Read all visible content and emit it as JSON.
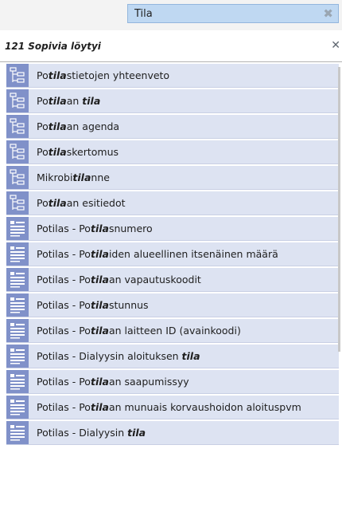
{
  "search": {
    "value": "Tila",
    "clear_icon": "close-icon"
  },
  "results": {
    "count_label": "121 Sopivia löytyi",
    "close_icon": "close-icon"
  },
  "items": [
    {
      "icon": "tree-icon",
      "segments": [
        {
          "t": "Po"
        },
        {
          "t": "tila",
          "b": true
        },
        {
          "t": "stietojen yhteenveto"
        }
      ]
    },
    {
      "icon": "tree-icon",
      "segments": [
        {
          "t": "Po"
        },
        {
          "t": "tila",
          "b": true
        },
        {
          "t": "an "
        },
        {
          "t": "tila",
          "b": true
        }
      ]
    },
    {
      "icon": "tree-icon",
      "segments": [
        {
          "t": "Po"
        },
        {
          "t": "tila",
          "b": true
        },
        {
          "t": "an agenda"
        }
      ]
    },
    {
      "icon": "tree-icon",
      "segments": [
        {
          "t": "Po"
        },
        {
          "t": "tila",
          "b": true
        },
        {
          "t": "skertomus"
        }
      ]
    },
    {
      "icon": "tree-icon",
      "segments": [
        {
          "t": "Mikrobi"
        },
        {
          "t": "tila",
          "b": true
        },
        {
          "t": "nne"
        }
      ]
    },
    {
      "icon": "tree-icon",
      "segments": [
        {
          "t": "Po"
        },
        {
          "t": "tila",
          "b": true
        },
        {
          "t": "an esitiedot"
        }
      ]
    },
    {
      "icon": "form-icon",
      "segments": [
        {
          "t": "Potilas - Po"
        },
        {
          "t": "tila",
          "b": true
        },
        {
          "t": "snumero"
        }
      ]
    },
    {
      "icon": "form-icon",
      "segments": [
        {
          "t": "Potilas - Po"
        },
        {
          "t": "tila",
          "b": true
        },
        {
          "t": "iden alueellinen itsenäinen määrä"
        }
      ]
    },
    {
      "icon": "form-icon",
      "segments": [
        {
          "t": "Potilas - Po"
        },
        {
          "t": "tila",
          "b": true
        },
        {
          "t": "an vapautuskoodit"
        }
      ]
    },
    {
      "icon": "form-icon",
      "segments": [
        {
          "t": "Potilas - Po"
        },
        {
          "t": "tila",
          "b": true
        },
        {
          "t": "stunnus"
        }
      ]
    },
    {
      "icon": "form-icon",
      "segments": [
        {
          "t": "Potilas - Po"
        },
        {
          "t": "tila",
          "b": true
        },
        {
          "t": "an laitteen ID (avainkoodi)"
        }
      ]
    },
    {
      "icon": "form-icon",
      "segments": [
        {
          "t": "Potilas - Dialyysin aloituksen "
        },
        {
          "t": "tila",
          "b": true
        }
      ]
    },
    {
      "icon": "form-icon",
      "segments": [
        {
          "t": "Potilas - Po"
        },
        {
          "t": "tila",
          "b": true
        },
        {
          "t": "an saapumissyy"
        }
      ]
    },
    {
      "icon": "form-icon",
      "segments": [
        {
          "t": "Potilas - Po"
        },
        {
          "t": "tila",
          "b": true
        },
        {
          "t": "an munuais korvaushoidon aloituspvm"
        }
      ]
    },
    {
      "icon": "form-icon",
      "segments": [
        {
          "t": "Potilas - Dialyysin "
        },
        {
          "t": "tila",
          "b": true
        }
      ]
    }
  ]
}
